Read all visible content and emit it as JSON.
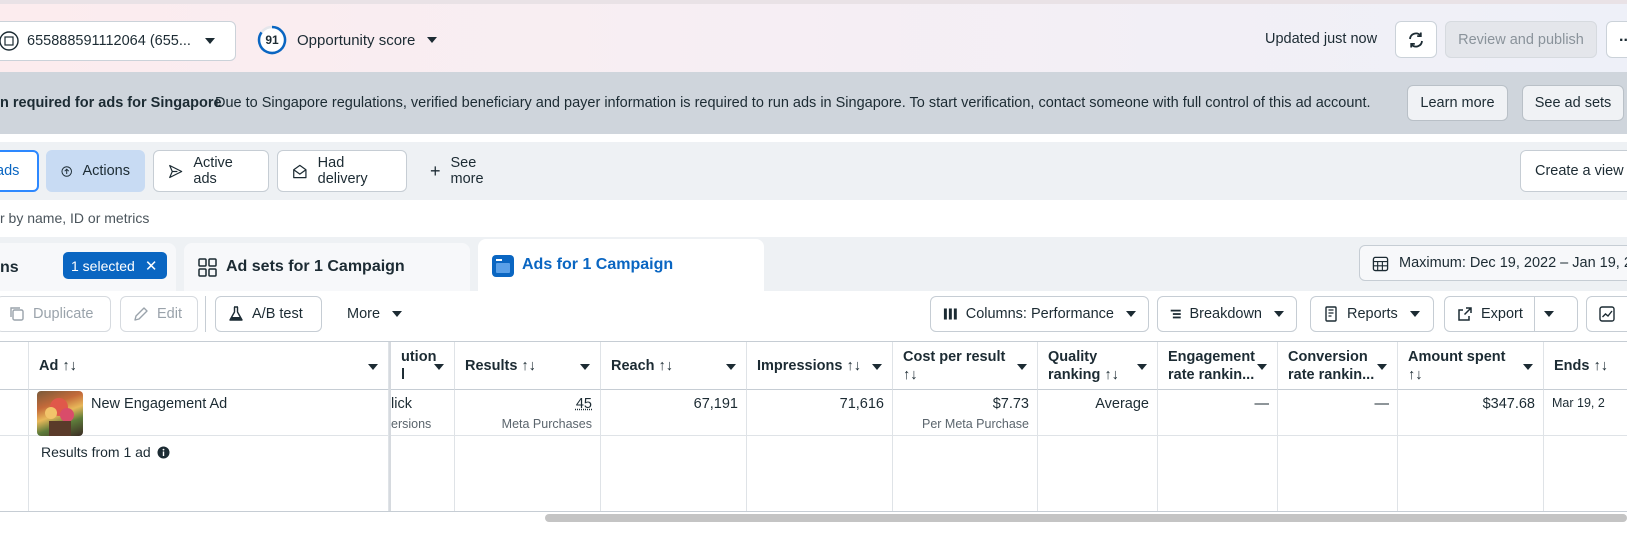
{
  "topbar": {
    "account_label": "655888591112064 (655...",
    "opportunity_score": "91",
    "opportunity_label": "Opportunity score",
    "updated": "Updated just now",
    "review_label": "Review and publish",
    "more_label": "..."
  },
  "banner": {
    "title": "n required for ads for Singapore",
    "text": "Due to Singapore regulations, verified beneficiary and payer information is required to run ads in Singapore. To start verification, contact someone with full control of this ad account.",
    "learn_more": "Learn more",
    "see_ad_sets": "See ad sets"
  },
  "filters": {
    "ads": "ads",
    "actions": "Actions",
    "active_ads": "Active ads",
    "had_delivery": "Had delivery",
    "see_more": "See more",
    "create_view": "Create a view"
  },
  "search": {
    "placeholder": "r by name, ID or metrics"
  },
  "tabs": {
    "campaigns_partial": "ns",
    "selected_badge": "1 selected",
    "ad_sets": "Ad sets for 1 Campaign",
    "ads": "Ads for 1 Campaign",
    "date_range": "Maximum: Dec 19, 2022 – Jan 19, 20"
  },
  "toolbar": {
    "duplicate": "Duplicate",
    "edit": "Edit",
    "ab_test": "A/B test",
    "more": "More",
    "columns": "Columns: Performance",
    "breakdown": "Breakdown",
    "reports": "Reports",
    "export": "Export"
  },
  "table": {
    "headers": {
      "ad": "Ad ↑↓",
      "attribution_l1": "ution",
      "attribution_l2": "l",
      "results": "Results ↑↓",
      "reach": "Reach ↑↓",
      "impressions": "Impressions ↑↓",
      "cost_l1": "Cost per result",
      "cost_l2": "↑↓",
      "quality_l1": "Quality",
      "quality_l2": "ranking ↑↓",
      "engagement_l1": "Engagement",
      "engagement_l2": "rate rankin...",
      "conversion_l1": "Conversion",
      "conversion_l2": "rate rankin...",
      "amount_l1": "Amount spent",
      "amount_l2": "↑↓",
      "ends": "Ends ↑↓"
    },
    "row": {
      "ad_name": "New Engagement Ad",
      "attribution_l1": "lick",
      "attribution_l2": "ersions",
      "results": "45",
      "results_sub": "Meta Purchases",
      "reach": "67,191",
      "impressions": "71,616",
      "cost": "$7.73",
      "cost_sub": "Per Meta Purchase",
      "quality": "Average",
      "engagement": "—",
      "conversion": "—",
      "amount": "$347.68",
      "ends": "Mar 19, 2"
    },
    "summary": "Results from 1 ad"
  },
  "colors": {
    "accent": "#0a66c2",
    "banner_bg": "#cfd5dc",
    "selected_chip": "#c8dbf3"
  }
}
